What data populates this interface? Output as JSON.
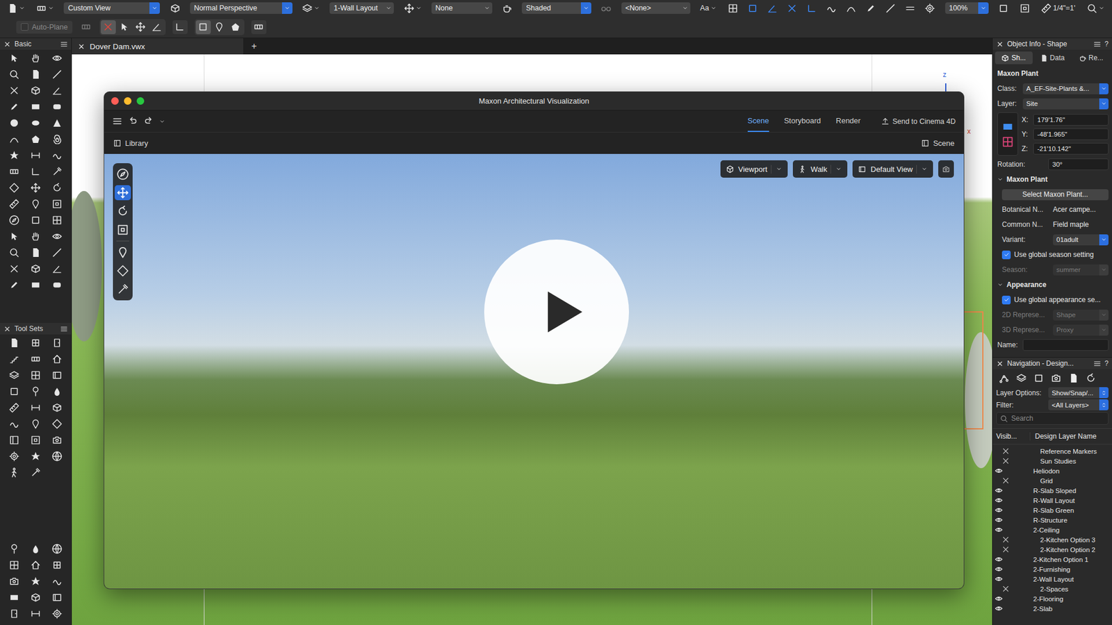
{
  "toolbar": {
    "view_menu": "Custom View",
    "projection": "Normal Perspective",
    "layer_menu": "1-Wall Layout",
    "snap_menu": "None",
    "render_mode": "Shaded",
    "class_menu": "<None>",
    "text_menu": "Aa",
    "snaps": [
      {
        "on": false
      },
      {
        "on": true
      },
      {
        "on": true
      },
      {
        "on": true
      },
      {
        "on": true
      },
      {
        "on": false
      },
      {
        "on": false
      },
      {
        "on": false
      },
      {
        "on": false
      },
      {
        "on": false
      },
      {
        "on": false
      }
    ],
    "zoom": "100%",
    "scale": "1/4\"=1'",
    "auto_plane": {
      "label": "Auto-Plane",
      "disabled": true
    },
    "plane_modes": [
      {
        "selected": true
      },
      {
        "selected": false
      },
      {
        "selected": false
      },
      {
        "selected": false
      }
    ],
    "selection_modes": [
      {
        "selected": true
      },
      {
        "selected": false
      },
      {
        "selected": false
      }
    ]
  },
  "document": {
    "tab": "Dover Dam.vwx",
    "add": "+"
  },
  "canvas": {
    "axes": [
      {
        "label": "z",
        "color": "#2a5bd7"
      },
      {
        "label": "x",
        "color": "#e0452b"
      }
    ]
  },
  "palettes": {
    "basic": "Basic",
    "tool_sets": "Tool Sets"
  },
  "viz": {
    "title": "Maxon Architectural Visualization",
    "tabs": [
      {
        "label": "Scene",
        "selected": true
      },
      {
        "label": "Storyboard",
        "selected": false
      },
      {
        "label": "Render",
        "selected": false
      }
    ],
    "send": "Send to Cinema 4D",
    "library": "Library",
    "scene_panel": "Scene",
    "viewport_controls": [
      {
        "label": "Viewport"
      },
      {
        "label": "Walk"
      },
      {
        "label": "Default View"
      }
    ],
    "tools": [
      {
        "selected": false
      },
      {
        "selected": true
      },
      {
        "selected": false
      },
      {
        "selected": false
      },
      {
        "selected": false
      },
      {
        "selected": false
      },
      {
        "selected": false
      }
    ]
  },
  "object_info": {
    "title": "Object Info - Shape",
    "help": "?",
    "tabs": [
      {
        "label": "Sh...",
        "selected": true
      },
      {
        "label": "Data",
        "selected": false
      },
      {
        "label": "Re...",
        "selected": false
      }
    ],
    "object_type": "Maxon Plant",
    "class": {
      "label": "Class:",
      "value": "A_EF-Site-Plants &..."
    },
    "layer": {
      "label": "Layer:",
      "value": "Site"
    },
    "coords": [
      {
        "label": "X:",
        "value": "179'1.76\""
      },
      {
        "label": "Y:",
        "value": "-48'1.965\""
      },
      {
        "label": "Z:",
        "value": "-21'10.142\""
      }
    ],
    "rotation": {
      "label": "Rotation:",
      "value": "30°"
    },
    "sections": [
      {
        "title": "Maxon Plant",
        "expanded": true,
        "rows": [
          {
            "kind": "button",
            "label": "Select Maxon Plant..."
          },
          {
            "kind": "field",
            "label": "Botanical N...",
            "value": "Acer campe..."
          },
          {
            "kind": "field",
            "label": "Common N...",
            "value": "Field maple"
          },
          {
            "kind": "select",
            "label": "Variant:",
            "value": "01adult",
            "disabled": false
          },
          {
            "kind": "checkbox",
            "label": "Use global season setting",
            "checked": true
          },
          {
            "kind": "select",
            "label": "Season:",
            "value": "summer",
            "disabled": true
          }
        ]
      },
      {
        "title": "Appearance",
        "expanded": true,
        "rows": [
          {
            "kind": "checkbox",
            "label": "Use global appearance se...",
            "checked": true
          },
          {
            "kind": "select",
            "label": "2D Represe...",
            "value": "Shape",
            "disabled": true
          },
          {
            "kind": "select",
            "label": "3D Represe...",
            "value": "Proxy",
            "disabled": true
          }
        ]
      }
    ],
    "name": {
      "label": "Name:",
      "value": ""
    }
  },
  "navigation": {
    "title": "Navigation - Design...",
    "help": "?",
    "layer_options": {
      "label": "Layer Options:",
      "value": "Show/Snap/..."
    },
    "filter": {
      "label": "Filter:",
      "value": "<All Layers>"
    },
    "search": {
      "placeholder": "Search"
    },
    "columns": [
      "Visib...",
      "Design Layer Name"
    ],
    "layers": [
      {
        "name": "Reference Markers",
        "visible": false
      },
      {
        "name": "Sun Studies",
        "visible": false
      },
      {
        "name": "Heliodon",
        "visible": true
      },
      {
        "name": "Grid",
        "visible": false
      },
      {
        "name": "R-Slab Sloped",
        "visible": true
      },
      {
        "name": "R-Wall Layout",
        "visible": true
      },
      {
        "name": "R-Slab Green",
        "visible": true
      },
      {
        "name": "R-Structure",
        "visible": true
      },
      {
        "name": "2-Ceiling",
        "visible": true
      },
      {
        "name": "2-Kitchen Option 3",
        "visible": false
      },
      {
        "name": "2-Kitchen Option 2",
        "visible": false
      },
      {
        "name": "2-Kitchen Option 1",
        "visible": true
      },
      {
        "name": "2-Furnishing",
        "visible": true
      },
      {
        "name": "2-Wall Layout",
        "visible": true
      },
      {
        "name": "2-Spaces",
        "visible": false
      },
      {
        "name": "2-Flooring",
        "visible": true
      },
      {
        "name": "2-Slab",
        "visible": true
      }
    ]
  }
}
